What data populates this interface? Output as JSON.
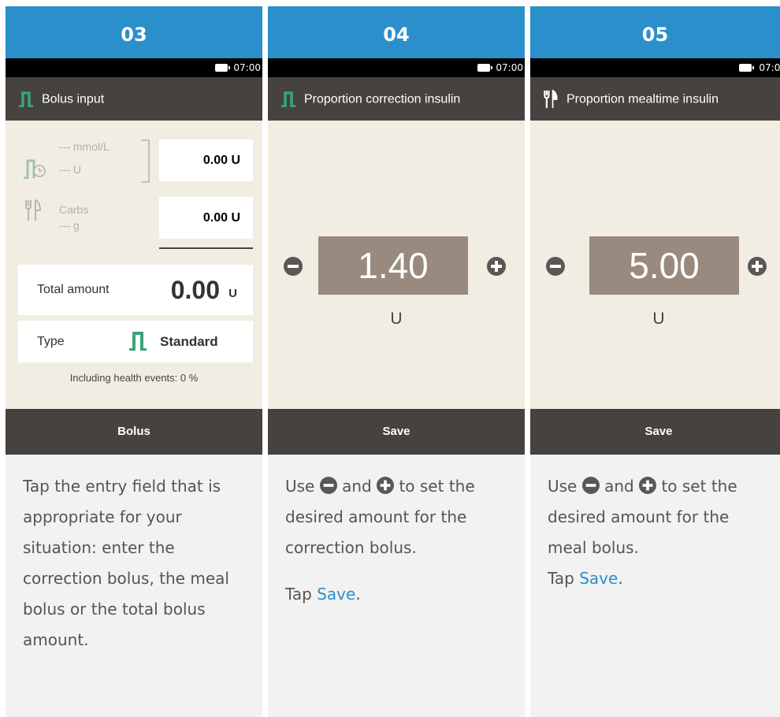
{
  "status_time": "07:00",
  "panels": [
    {
      "step": "03",
      "header_title": "Bolus input",
      "header_icon": "bolus-standard-icon",
      "correction_glucose": "--- mmol/L",
      "correction_units": "--- U",
      "correction_field_value": "0.00 U",
      "carbs_label": "Carbs",
      "carbs_amount": "--- g",
      "meal_field_value": "0.00 U",
      "total_label": "Total amount",
      "total_value": "0.00",
      "total_unit": "U",
      "type_label": "Type",
      "type_value": "Standard",
      "health_events": "Including health events: 0 %",
      "action_label": "Bolus",
      "desc_text": "Tap the entry field that is appropriate for your situation: enter the correction bolus, the meal bolus or the total bolus amount."
    },
    {
      "step": "04",
      "header_title": "Proportion correction insulin",
      "header_icon": "bolus-standard-icon",
      "value": "1.40",
      "unit": "U",
      "action_label": "Save",
      "desc_use": "Use",
      "desc_and": "and",
      "desc_to_set": "to set the desired amount for the correction bolus.",
      "desc_tap": "Tap",
      "desc_link": "Save",
      "desc_period": "."
    },
    {
      "step": "05",
      "header_title": "Proportion mealtime insulin",
      "header_icon": "fork-knife-icon",
      "value": "5.00",
      "unit": "U",
      "action_label": "Save",
      "desc_use": "Use",
      "desc_and": "and",
      "desc_to_set": "to set the desired amount for the meal bolus.",
      "desc_tap": "Tap",
      "desc_link": "Save",
      "desc_period": "."
    }
  ],
  "colors": {
    "step_blue": "#2b8fcb",
    "header_dark": "#454240",
    "content_beige": "#f1ede2",
    "value_box": "#988a7e",
    "bolus_green": "#3aa37a"
  }
}
